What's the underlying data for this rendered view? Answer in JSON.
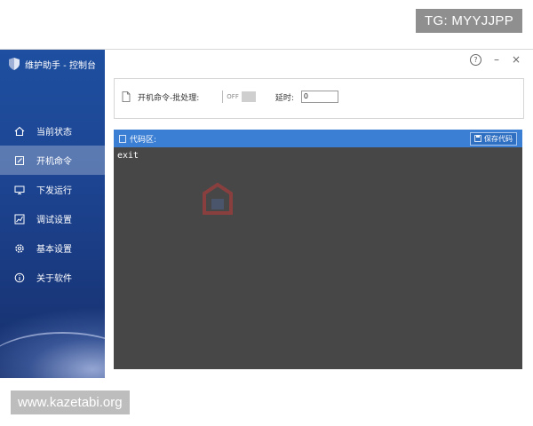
{
  "overlay": {
    "top_badge": "TG: MYYJJPP",
    "bottom_badge": "www.kazetabi.org"
  },
  "app": {
    "title": "维护助手 - 控制台"
  },
  "sidebar": {
    "items": [
      {
        "label": "当前状态",
        "icon": "home-icon",
        "active": false
      },
      {
        "label": "开机命令",
        "icon": "edit-icon",
        "active": true
      },
      {
        "label": "下发运行",
        "icon": "monitor-icon",
        "active": false
      },
      {
        "label": "调试设置",
        "icon": "chart-icon",
        "active": false
      },
      {
        "label": "基本设置",
        "icon": "gear-icon",
        "active": false
      },
      {
        "label": "关于软件",
        "icon": "info-icon",
        "active": false
      }
    ]
  },
  "window_controls": {
    "help": "?",
    "minimize": "–",
    "close": "×"
  },
  "settings": {
    "label": "开机命令-批处理:",
    "toggle_state": "OFF",
    "delay_label": "延时:",
    "delay_value": "0"
  },
  "code": {
    "header_label": "代码区:",
    "save_label": "保存代码",
    "content": "exit"
  },
  "colors": {
    "sidebar": "#1d4694",
    "header_blue": "#3b7fd4",
    "editor_bg": "#474747"
  }
}
